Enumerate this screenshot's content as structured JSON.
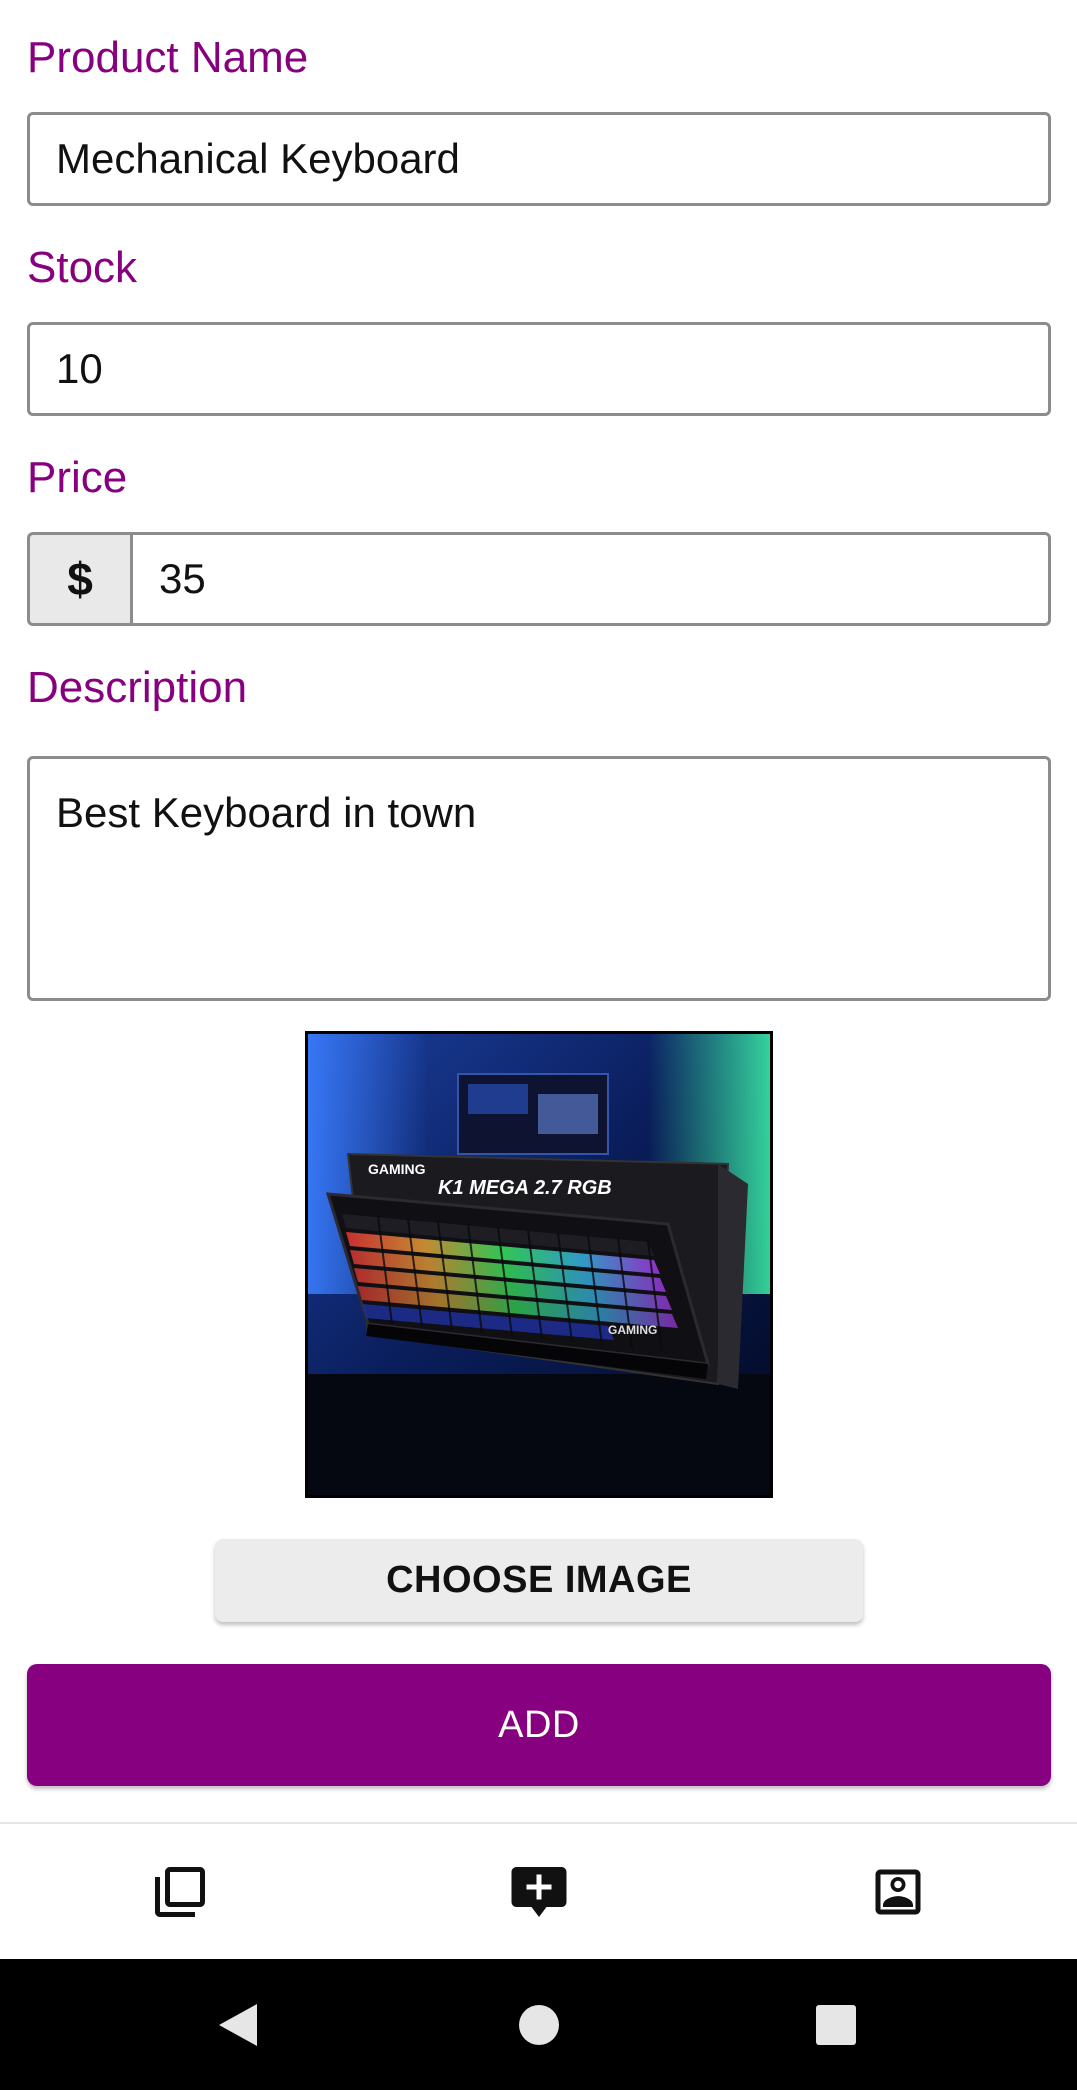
{
  "form": {
    "product_name": {
      "label": "Product Name",
      "value": "Mechanical Keyboard"
    },
    "stock": {
      "label": "Stock",
      "value": "10"
    },
    "price": {
      "label": "Price",
      "currency_symbol": "$",
      "value": "35"
    },
    "description": {
      "label": "Description",
      "value": "Best Keyboard in town"
    }
  },
  "image": {
    "brand_text": "GAMING",
    "model_text": "K1 MEGA 2.7 RGB"
  },
  "buttons": {
    "choose_image": "CHOOSE IMAGE",
    "add": "ADD"
  },
  "bottom_nav": {
    "items": [
      {
        "icon": "library-icon"
      },
      {
        "icon": "add-comment-icon",
        "active": true
      },
      {
        "icon": "contact-icon"
      }
    ]
  },
  "system_nav": {
    "buttons": [
      "back",
      "home",
      "recents"
    ]
  },
  "colors": {
    "accent": "#87007f",
    "field_border": "#8c8c8c",
    "button_gray": "#ececec"
  }
}
